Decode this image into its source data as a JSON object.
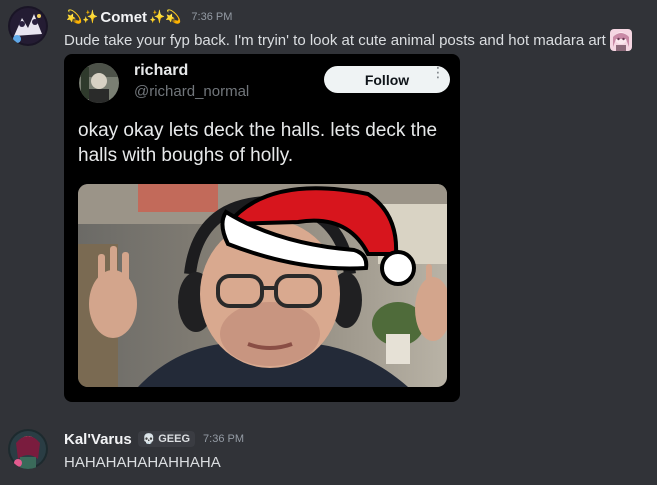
{
  "messages": [
    {
      "username": "Comet",
      "deco_left": "💫✨",
      "deco_right": "✨💫",
      "time": "7:36 PM",
      "text": "Dude take your fyp back. I'm tryin' to look at cute animal posts and hot madara art",
      "embed": {
        "name": "richard",
        "handle": "@richard_normal",
        "follow_label": "Follow",
        "more_label": "⋮",
        "text": "okay okay lets deck the halls. lets deck the halls with boughs of holly."
      }
    },
    {
      "username": "Kal'Varus",
      "badge": "GEEG",
      "badge_icon": "💀",
      "time": "7:36 PM",
      "text": "HAHAHAHAHAHHAHA"
    }
  ],
  "colors": {
    "background": "#313338",
    "username": "#f2f3f5",
    "timestamp": "#949ba4",
    "embed_bg": "#000000",
    "follow_bg": "#eff3f4"
  }
}
